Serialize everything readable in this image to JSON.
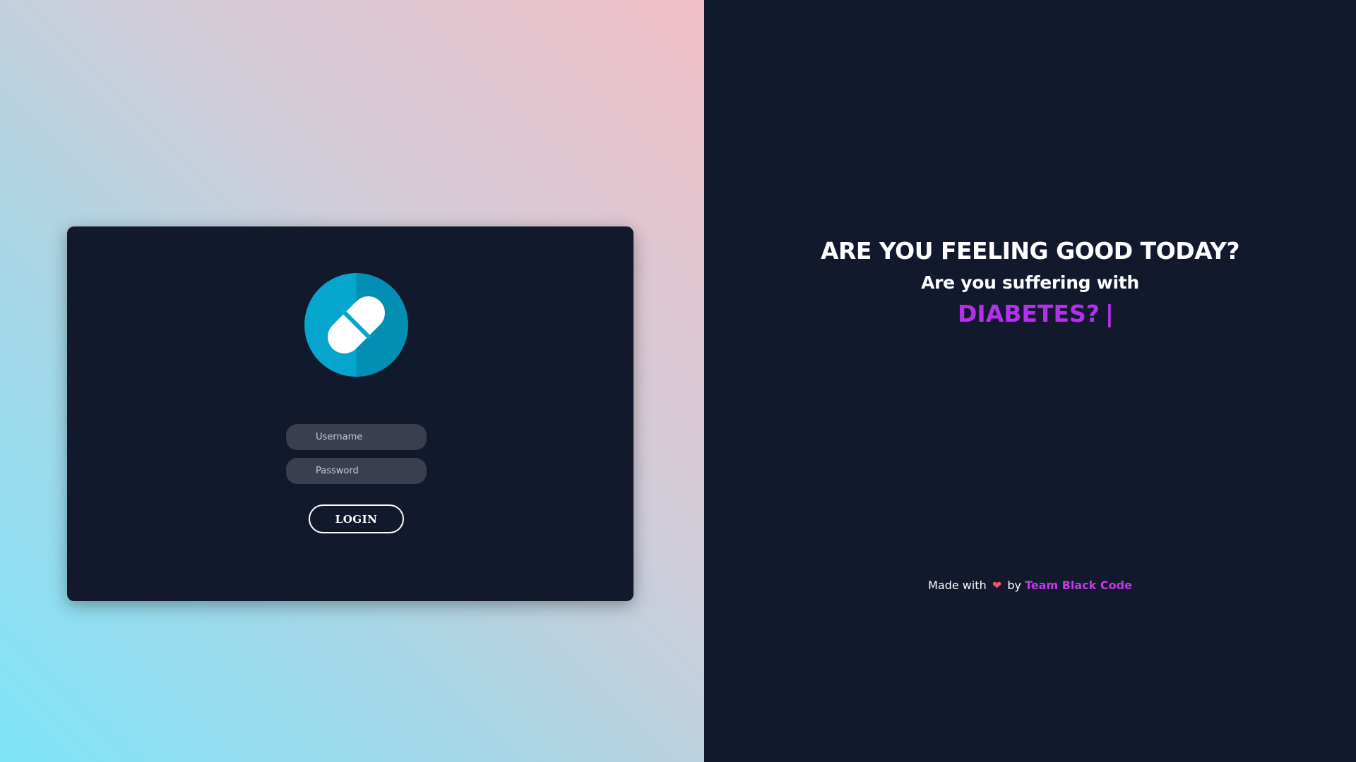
{
  "login": {
    "username_placeholder": "Username",
    "password_placeholder": "Password",
    "login_label": "LOGIN"
  },
  "hero": {
    "headline": "ARE YOU FEELING GOOD TODAY?",
    "subline": "Are you suffering with",
    "typed_word": "DIABETES?",
    "cursor": "|"
  },
  "footer": {
    "made_with": "Made with",
    "heart": "❤",
    "by": "by",
    "team": "Team Black Code"
  },
  "colors": {
    "panel_dark": "#13192d",
    "accent_purple": "#b42ff0",
    "logo_blue": "#05a6cd",
    "heart_red": "#ff4f5e"
  },
  "icons": {
    "logo": "pill-icon",
    "heart": "heart-icon"
  }
}
